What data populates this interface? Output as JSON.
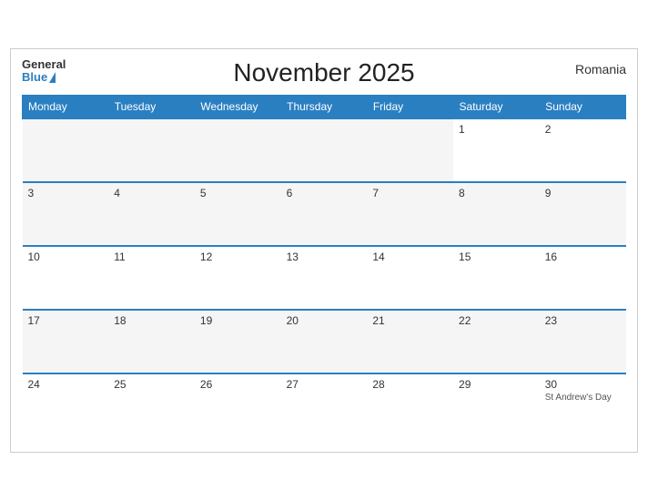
{
  "header": {
    "title": "November 2025",
    "country": "Romania",
    "logo_general": "General",
    "logo_blue": "Blue"
  },
  "weekdays": [
    "Monday",
    "Tuesday",
    "Wednesday",
    "Thursday",
    "Friday",
    "Saturday",
    "Sunday"
  ],
  "weeks": [
    [
      {
        "day": "",
        "empty": true
      },
      {
        "day": "",
        "empty": true
      },
      {
        "day": "",
        "empty": true
      },
      {
        "day": "",
        "empty": true
      },
      {
        "day": "",
        "empty": true
      },
      {
        "day": "1",
        "empty": false
      },
      {
        "day": "2",
        "empty": false
      }
    ],
    [
      {
        "day": "3",
        "empty": false
      },
      {
        "day": "4",
        "empty": false
      },
      {
        "day": "5",
        "empty": false
      },
      {
        "day": "6",
        "empty": false
      },
      {
        "day": "7",
        "empty": false
      },
      {
        "day": "8",
        "empty": false
      },
      {
        "day": "9",
        "empty": false
      }
    ],
    [
      {
        "day": "10",
        "empty": false
      },
      {
        "day": "11",
        "empty": false
      },
      {
        "day": "12",
        "empty": false
      },
      {
        "day": "13",
        "empty": false
      },
      {
        "day": "14",
        "empty": false
      },
      {
        "day": "15",
        "empty": false
      },
      {
        "day": "16",
        "empty": false
      }
    ],
    [
      {
        "day": "17",
        "empty": false
      },
      {
        "day": "18",
        "empty": false
      },
      {
        "day": "19",
        "empty": false
      },
      {
        "day": "20",
        "empty": false
      },
      {
        "day": "21",
        "empty": false
      },
      {
        "day": "22",
        "empty": false
      },
      {
        "day": "23",
        "empty": false
      }
    ],
    [
      {
        "day": "24",
        "empty": false
      },
      {
        "day": "25",
        "empty": false
      },
      {
        "day": "26",
        "empty": false
      },
      {
        "day": "27",
        "empty": false
      },
      {
        "day": "28",
        "empty": false
      },
      {
        "day": "29",
        "empty": false
      },
      {
        "day": "30",
        "empty": false,
        "event": "St Andrew's Day"
      }
    ]
  ]
}
